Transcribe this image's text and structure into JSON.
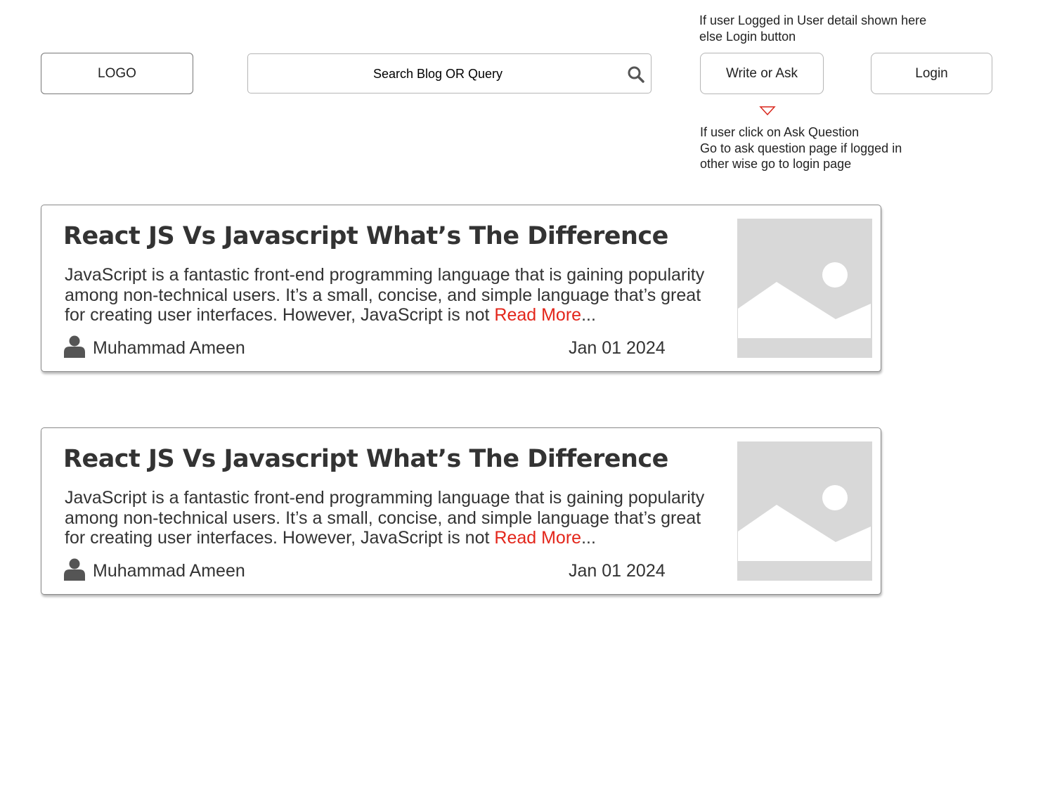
{
  "header": {
    "logo_label": "LOGO",
    "search_placeholder": "Search Blog OR Query",
    "write_label": "Write or Ask",
    "login_label": "Login"
  },
  "annotations": {
    "user_note": [
      "If user Logged in User detail shown here",
      "else Login button"
    ],
    "ask_note": [
      "If user click on Ask Question",
      "Go to ask question page if logged in",
      "other wise go to login page"
    ]
  },
  "posts": [
    {
      "title": "React JS Vs Javascript What’s The Difference",
      "excerpt_lines": [
        "JavaScript is a fantastic front-end programming language that is gaining popularity",
        "among non-technical users. It’s a small, concise, and simple language that’s great",
        "for creating user interfaces. However, JavaScript is not "
      ],
      "read_more": "Read More",
      "ellipsis": "...",
      "author": "Muhammad Ameen",
      "date": "Jan 01 2024"
    },
    {
      "title": "React JS Vs Javascript What’s The Difference",
      "excerpt_lines": [
        "JavaScript is a fantastic front-end programming language that is gaining popularity",
        "among non-technical users. It’s a small, concise, and simple language that’s great",
        "for creating user interfaces. However, JavaScript is not "
      ],
      "read_more": "Read More",
      "ellipsis": "...",
      "author": "Muhammad Ameen",
      "date": "Jan 01 2024"
    }
  ],
  "colors": {
    "link": "#e3261b",
    "text": "#333333",
    "placeholder_bg": "#d8d8d8",
    "arrow": "#d9261c"
  },
  "icons": {
    "search": "search-icon",
    "author": "user-icon",
    "thumbnail": "image-placeholder-icon",
    "arrow": "triangle-down-icon"
  }
}
